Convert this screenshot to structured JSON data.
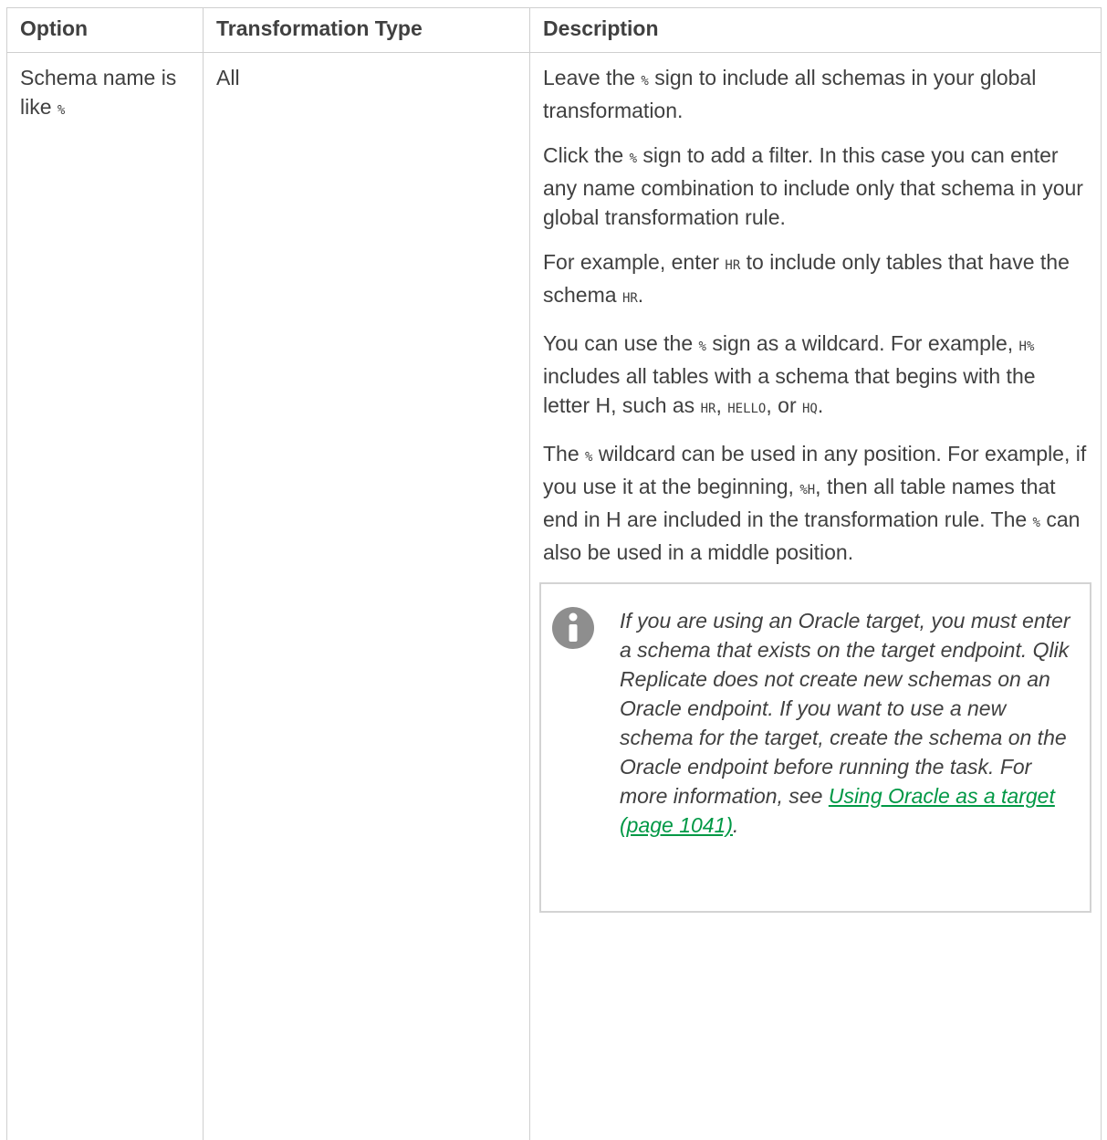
{
  "table": {
    "headers": [
      "Option",
      "Transformation Type",
      "Description"
    ],
    "row": {
      "option_text": "Schema name is like",
      "option_code": "%",
      "type": "All",
      "paragraphs": [
        [
          {
            "t": "Leave the "
          },
          {
            "c": "%"
          },
          {
            "t": " sign to include all schemas in your global transformation."
          }
        ],
        [
          {
            "t": "Click the "
          },
          {
            "c": "%"
          },
          {
            "t": " sign to add a filter. In this case you can enter any name combination to include only that schema in your global transformation rule."
          }
        ],
        [
          {
            "t": "For example, enter "
          },
          {
            "c": "HR"
          },
          {
            "t": " to include only tables that have the schema "
          },
          {
            "c": "HR"
          },
          {
            "t": "."
          }
        ],
        [
          {
            "t": "You can use the "
          },
          {
            "c": "%"
          },
          {
            "t": " sign as a wildcard. For example, "
          },
          {
            "c": "H%"
          },
          {
            "t": " includes all tables with a schema that begins with the letter H, such as "
          },
          {
            "c": "HR"
          },
          {
            "t": ", "
          },
          {
            "c": "HELLO"
          },
          {
            "t": ", or "
          },
          {
            "c": "HQ"
          },
          {
            "t": "."
          }
        ],
        [
          {
            "t": "The "
          },
          {
            "c": "%"
          },
          {
            "t": " wildcard can be used in any position. For example, if you use it at the beginning, "
          },
          {
            "c": "%H"
          },
          {
            "t": ", then all table names that end in H are included in the transformation rule. The "
          },
          {
            "c": "%"
          },
          {
            "t": " can also be used in a middle position."
          }
        ]
      ],
      "note": {
        "icon": "info-icon",
        "text": "If you are using an Oracle target, you must enter a schema that exists on the target endpoint. Qlik Replicate does not create new schemas on an Oracle endpoint. If you want to use a new schema for the target, create the schema on the Oracle endpoint before running the task. For more information, see ",
        "link_text": "Using Oracle as a target (page 1041)",
        "after_link": "."
      }
    }
  },
  "colors": {
    "link": "#009845",
    "border": "#cfcfcf",
    "icon": "#8e8e8e",
    "text": "#404040"
  }
}
